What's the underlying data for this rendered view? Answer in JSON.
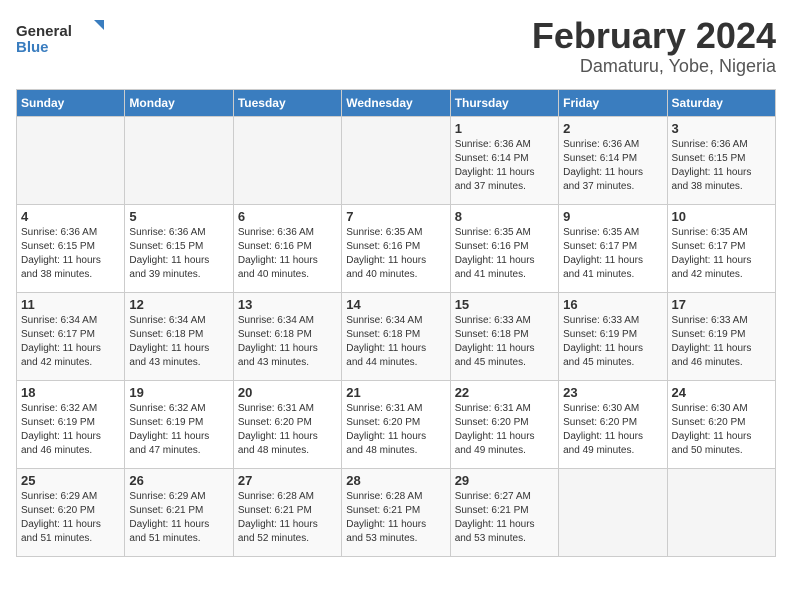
{
  "header": {
    "logo_general": "General",
    "logo_blue": "Blue",
    "month": "February 2024",
    "location": "Damaturu, Yobe, Nigeria"
  },
  "weekdays": [
    "Sunday",
    "Monday",
    "Tuesday",
    "Wednesday",
    "Thursday",
    "Friday",
    "Saturday"
  ],
  "weeks": [
    [
      {
        "day": "",
        "info": ""
      },
      {
        "day": "",
        "info": ""
      },
      {
        "day": "",
        "info": ""
      },
      {
        "day": "",
        "info": ""
      },
      {
        "day": "1",
        "info": "Sunrise: 6:36 AM\nSunset: 6:14 PM\nDaylight: 11 hours\nand 37 minutes."
      },
      {
        "day": "2",
        "info": "Sunrise: 6:36 AM\nSunset: 6:14 PM\nDaylight: 11 hours\nand 37 minutes."
      },
      {
        "day": "3",
        "info": "Sunrise: 6:36 AM\nSunset: 6:15 PM\nDaylight: 11 hours\nand 38 minutes."
      }
    ],
    [
      {
        "day": "4",
        "info": "Sunrise: 6:36 AM\nSunset: 6:15 PM\nDaylight: 11 hours\nand 38 minutes."
      },
      {
        "day": "5",
        "info": "Sunrise: 6:36 AM\nSunset: 6:15 PM\nDaylight: 11 hours\nand 39 minutes."
      },
      {
        "day": "6",
        "info": "Sunrise: 6:36 AM\nSunset: 6:16 PM\nDaylight: 11 hours\nand 40 minutes."
      },
      {
        "day": "7",
        "info": "Sunrise: 6:35 AM\nSunset: 6:16 PM\nDaylight: 11 hours\nand 40 minutes."
      },
      {
        "day": "8",
        "info": "Sunrise: 6:35 AM\nSunset: 6:16 PM\nDaylight: 11 hours\nand 41 minutes."
      },
      {
        "day": "9",
        "info": "Sunrise: 6:35 AM\nSunset: 6:17 PM\nDaylight: 11 hours\nand 41 minutes."
      },
      {
        "day": "10",
        "info": "Sunrise: 6:35 AM\nSunset: 6:17 PM\nDaylight: 11 hours\nand 42 minutes."
      }
    ],
    [
      {
        "day": "11",
        "info": "Sunrise: 6:34 AM\nSunset: 6:17 PM\nDaylight: 11 hours\nand 42 minutes."
      },
      {
        "day": "12",
        "info": "Sunrise: 6:34 AM\nSunset: 6:18 PM\nDaylight: 11 hours\nand 43 minutes."
      },
      {
        "day": "13",
        "info": "Sunrise: 6:34 AM\nSunset: 6:18 PM\nDaylight: 11 hours\nand 43 minutes."
      },
      {
        "day": "14",
        "info": "Sunrise: 6:34 AM\nSunset: 6:18 PM\nDaylight: 11 hours\nand 44 minutes."
      },
      {
        "day": "15",
        "info": "Sunrise: 6:33 AM\nSunset: 6:18 PM\nDaylight: 11 hours\nand 45 minutes."
      },
      {
        "day": "16",
        "info": "Sunrise: 6:33 AM\nSunset: 6:19 PM\nDaylight: 11 hours\nand 45 minutes."
      },
      {
        "day": "17",
        "info": "Sunrise: 6:33 AM\nSunset: 6:19 PM\nDaylight: 11 hours\nand 46 minutes."
      }
    ],
    [
      {
        "day": "18",
        "info": "Sunrise: 6:32 AM\nSunset: 6:19 PM\nDaylight: 11 hours\nand 46 minutes."
      },
      {
        "day": "19",
        "info": "Sunrise: 6:32 AM\nSunset: 6:19 PM\nDaylight: 11 hours\nand 47 minutes."
      },
      {
        "day": "20",
        "info": "Sunrise: 6:31 AM\nSunset: 6:20 PM\nDaylight: 11 hours\nand 48 minutes."
      },
      {
        "day": "21",
        "info": "Sunrise: 6:31 AM\nSunset: 6:20 PM\nDaylight: 11 hours\nand 48 minutes."
      },
      {
        "day": "22",
        "info": "Sunrise: 6:31 AM\nSunset: 6:20 PM\nDaylight: 11 hours\nand 49 minutes."
      },
      {
        "day": "23",
        "info": "Sunrise: 6:30 AM\nSunset: 6:20 PM\nDaylight: 11 hours\nand 49 minutes."
      },
      {
        "day": "24",
        "info": "Sunrise: 6:30 AM\nSunset: 6:20 PM\nDaylight: 11 hours\nand 50 minutes."
      }
    ],
    [
      {
        "day": "25",
        "info": "Sunrise: 6:29 AM\nSunset: 6:20 PM\nDaylight: 11 hours\nand 51 minutes."
      },
      {
        "day": "26",
        "info": "Sunrise: 6:29 AM\nSunset: 6:21 PM\nDaylight: 11 hours\nand 51 minutes."
      },
      {
        "day": "27",
        "info": "Sunrise: 6:28 AM\nSunset: 6:21 PM\nDaylight: 11 hours\nand 52 minutes."
      },
      {
        "day": "28",
        "info": "Sunrise: 6:28 AM\nSunset: 6:21 PM\nDaylight: 11 hours\nand 53 minutes."
      },
      {
        "day": "29",
        "info": "Sunrise: 6:27 AM\nSunset: 6:21 PM\nDaylight: 11 hours\nand 53 minutes."
      },
      {
        "day": "",
        "info": ""
      },
      {
        "day": "",
        "info": ""
      }
    ]
  ]
}
